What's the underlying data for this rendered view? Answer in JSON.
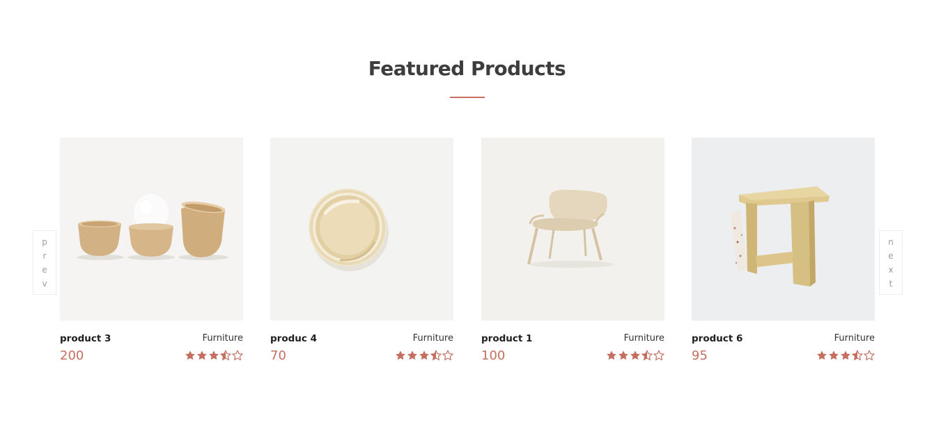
{
  "section": {
    "title": "Featured Products",
    "accent_color": "#c46f5f"
  },
  "carousel": {
    "prev_label": [
      "p",
      "r",
      "e",
      "v"
    ],
    "next_label": [
      "n",
      "e",
      "x",
      "t"
    ]
  },
  "products": [
    {
      "name": "product 3",
      "category": "Furniture",
      "price": "200",
      "rating": 3.5,
      "image_icon": "wooden-cups-egg-image"
    },
    {
      "name": "produc 4",
      "category": "Furniture",
      "price": "70",
      "rating": 3.5,
      "image_icon": "round-tray-image"
    },
    {
      "name": "product 1",
      "category": "Furniture",
      "price": "100",
      "rating": 3.5,
      "image_icon": "chair-image"
    },
    {
      "name": "product 6",
      "category": "Furniture",
      "price": "95",
      "rating": 3.5,
      "image_icon": "wooden-stool-image"
    }
  ]
}
